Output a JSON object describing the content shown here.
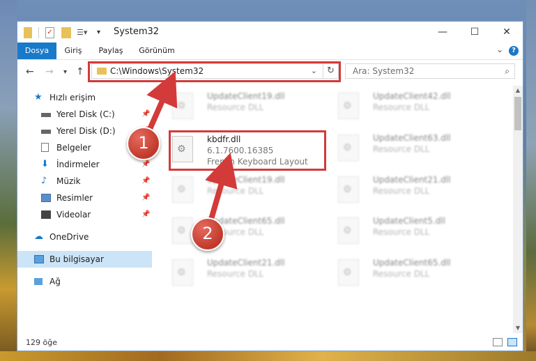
{
  "window": {
    "title": "System32",
    "controls": {
      "minimize": "—",
      "maximize": "☐",
      "close": "✕"
    }
  },
  "ribbon": {
    "tabs": [
      {
        "label": "Dosya",
        "active": true
      },
      {
        "label": "Giriş"
      },
      {
        "label": "Paylaş"
      },
      {
        "label": "Görünüm"
      }
    ],
    "help": "?"
  },
  "address": {
    "path": "C:\\Windows\\System32",
    "search_placeholder": "Ara: System32"
  },
  "nav": {
    "quick_access": "Hızlı erişim",
    "items": [
      {
        "label": "Yerel Disk (C:)",
        "pinned": true
      },
      {
        "label": "Yerel Disk (D:)",
        "pinned": true
      },
      {
        "label": "Belgeler",
        "pinned": true
      },
      {
        "label": "İndirmeler",
        "pinned": true
      },
      {
        "label": "Müzik",
        "pinned": true
      },
      {
        "label": "Resimler",
        "pinned": true
      },
      {
        "label": "Videolar",
        "pinned": true
      }
    ],
    "onedrive": "OneDrive",
    "this_pc": "Bu bilgisayar",
    "network": "Ağ"
  },
  "files": {
    "left": [
      {
        "name": "UpdateClient19.dll",
        "desc": "Resource DLL",
        "blurred": true
      },
      {
        "name": "kbdfr.dll",
        "desc": "6.1.7600.16385",
        "desc2": "French Keyboard Layout",
        "blurred": false
      },
      {
        "name": "UpdateClient19.dll",
        "desc": "Resource DLL",
        "blurred": true
      },
      {
        "name": "UpdateClient65.dll",
        "desc": "Resource DLL",
        "blurred": true
      },
      {
        "name": "UpdateClient21.dll",
        "desc": "Resource DLL",
        "blurred": true
      }
    ],
    "right": [
      {
        "name": "UpdateClient42.dll",
        "desc": "Resource DLL"
      },
      {
        "name": "UpdateClient63.dll",
        "desc": "Resource DLL"
      },
      {
        "name": "UpdateClient21.dll",
        "desc": "Resource DLL"
      },
      {
        "name": "UpdateClient5.dll",
        "desc": "Resource DLL"
      },
      {
        "name": "UpdateClient65.dll",
        "desc": "Resource DLL"
      }
    ]
  },
  "status": {
    "count": "129 öğe"
  },
  "annotations": {
    "step1": "1",
    "step2": "2"
  },
  "colors": {
    "accent": "#1979ca",
    "highlight": "#d33a3a",
    "selected": "#cce4f7"
  }
}
